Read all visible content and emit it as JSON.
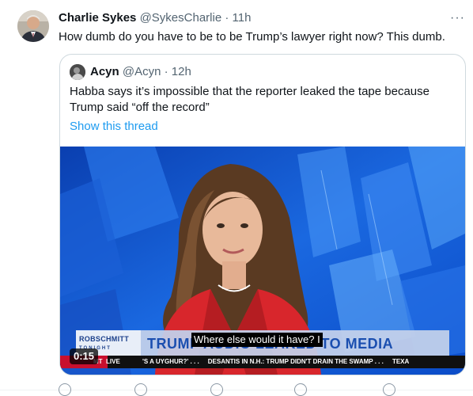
{
  "tweet": {
    "author_name": "Charlie Sykes",
    "author_handle": "@SykesCharlie",
    "separator": "·",
    "time": "11h",
    "more_label": "···",
    "text": "How dumb do you have to be to be Trump’s lawyer right now? This dumb."
  },
  "quote": {
    "author_name": "Acyn",
    "author_handle": "@Acyn",
    "separator": "·",
    "time": "12h",
    "text": "Habba says it’s impossible that the reporter leaked the tape because Trump said “off the record”",
    "show_thread": "Show this thread"
  },
  "video": {
    "show_logo": "ROBSCHMITT",
    "show_logo_sub": "TONIGHT",
    "headline": "TRUMP AUDIO LEAKED TO MEDIA",
    "caption": "Where else would it have? I",
    "ticker_left": "MT  LIVE",
    "ticker_text": "'S A UYGHUR?' . . .     DESANTIS IN N.H.: TRUMP DIDN'T DRAIN THE SWAMP . . .     TEXA",
    "elapsed": "0:15"
  },
  "colors": {
    "link": "#1d9bf0",
    "muted": "#536471",
    "border": "#cfd9de",
    "video_blue": "#0b4fc4",
    "ticker_red": "#c8102e"
  },
  "icons": [
    "reply-icon",
    "retweet-icon",
    "like-icon",
    "views-icon",
    "share-icon"
  ]
}
